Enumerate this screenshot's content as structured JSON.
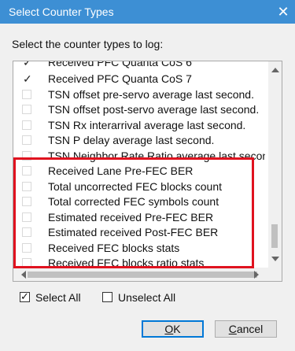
{
  "window": {
    "title": "Select Counter Types",
    "close": "✕"
  },
  "prompt": "Select the counter types to log:",
  "list": {
    "items": [
      {
        "label": "Received PFC Quanta CoS 6",
        "checked": true
      },
      {
        "label": "Received PFC Quanta CoS 7",
        "checked": true
      },
      {
        "label": "TSN offset pre-servo average last second.",
        "checked": false
      },
      {
        "label": "TSN offset post-servo average last second.",
        "checked": false
      },
      {
        "label": "TSN Rx interarrival average last second.",
        "checked": false
      },
      {
        "label": "TSN P delay average last second.",
        "checked": false
      },
      {
        "label": "TSN Neighbor Rate Ratio average last second.",
        "checked": false
      },
      {
        "label": "Received Lane Pre-FEC BER",
        "checked": false
      },
      {
        "label": "Total uncorrected FEC blocks count",
        "checked": false
      },
      {
        "label": "Total corrected FEC symbols count",
        "checked": false
      },
      {
        "label": "Estimated received Pre-FEC BER",
        "checked": false
      },
      {
        "label": "Estimated received Post-FEC BER",
        "checked": false
      },
      {
        "label": "Received FEC blocks stats",
        "checked": false
      },
      {
        "label": "Received FEC blocks ratio stats",
        "checked": false
      }
    ]
  },
  "select_all": {
    "label": "Select All",
    "checked": true
  },
  "unselect_all": {
    "label": "Unselect All",
    "checked": false
  },
  "buttons": {
    "ok": {
      "label_underlined": "O",
      "label_rest": "K"
    },
    "cancel": {
      "label_underlined": "C",
      "label_rest": "ancel"
    }
  },
  "colors": {
    "titlebar": "#3d8fd4",
    "highlight": "#e0121f",
    "primary_border": "#0078d7"
  }
}
